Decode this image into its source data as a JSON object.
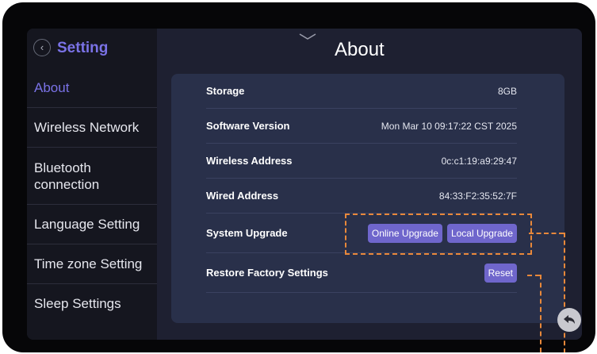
{
  "sidebar": {
    "title": "Setting",
    "items": [
      {
        "label": "About",
        "active": true
      },
      {
        "label": "Wireless Network"
      },
      {
        "label": "Bluetooth connection"
      },
      {
        "label": "Language Setting"
      },
      {
        "label": "Time zone Setting"
      },
      {
        "label": "Sleep Settings"
      }
    ]
  },
  "page": {
    "title": "About"
  },
  "about": {
    "storage": {
      "label": "Storage",
      "value": "8GB"
    },
    "software_version": {
      "label": "Software Version",
      "value": "Mon Mar 10 09:17:22 CST 2025"
    },
    "wireless_address": {
      "label": "Wireless Address",
      "value": "0c:c1:19:a9:29:47"
    },
    "wired_address": {
      "label": "Wired Address",
      "value": "84:33:F2:35:52:7F"
    },
    "system_upgrade": {
      "label": "System Upgrade",
      "online_button": "Online Upgrade",
      "local_button": "Local Upgrade"
    },
    "restore": {
      "label": "Restore Factory Settings",
      "reset_button": "Reset"
    }
  },
  "colors": {
    "accent": "#7a72e6",
    "button": "#6f66cc",
    "annotation": "#e8883a",
    "panel": "#29304a",
    "sidebar": "#15161f"
  },
  "icons": [
    "chevron-left-icon",
    "chevron-down-icon",
    "back-arrow-icon"
  ]
}
